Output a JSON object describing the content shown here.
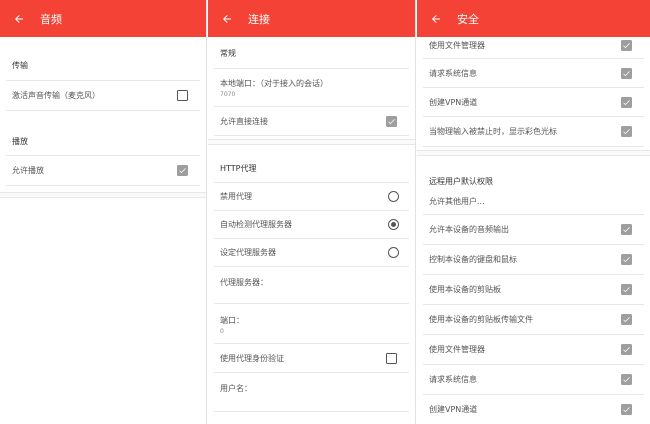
{
  "panel_audio": {
    "title": "音频",
    "section_transfer": "传输",
    "activate_mic_label": "激活声音传输（麦克风）",
    "section_playback": "播放",
    "allow_playback_label": "允许播放"
  },
  "panel_connection": {
    "title": "连接",
    "section_general": "常规",
    "local_port_label": "本地端口：（对于接入的会话）",
    "local_port_value": "7070",
    "allow_direct_label": "允许直接连接",
    "section_http_proxy": "HTTP代理",
    "proxy_disable_label": "禁用代理",
    "proxy_auto_label": "自动检测代理服务器",
    "proxy_manual_label": "设定代理服务器",
    "proxy_server_label": "代理服务器：",
    "port_label": "端口：",
    "port_value": "0",
    "use_proxy_auth_label": "使用代理身份验证",
    "username_label": "用户名："
  },
  "panel_security": {
    "title": "安全",
    "top_items": [
      "使用文件管理器",
      "请求系统信息",
      "创建VPN通道",
      "当物理输入被禁止时，显示彩色光标"
    ],
    "section_remote_default": "远程用户默认权限",
    "allow_others_label": "允许其他用户...",
    "permission_items": [
      "允许本设备的音频输出",
      "控制本设备的键盘和鼠标",
      "使用本设备的剪贴板",
      "使用本设备的剪贴板传输文件",
      "使用文件管理器",
      "请求系统信息",
      "创建VPN通道"
    ]
  },
  "icons": {
    "back": "arrow-left-icon",
    "check": "checkmark-icon"
  },
  "colors": {
    "appbar": "#f44336",
    "checked": "#9e9e9e"
  }
}
